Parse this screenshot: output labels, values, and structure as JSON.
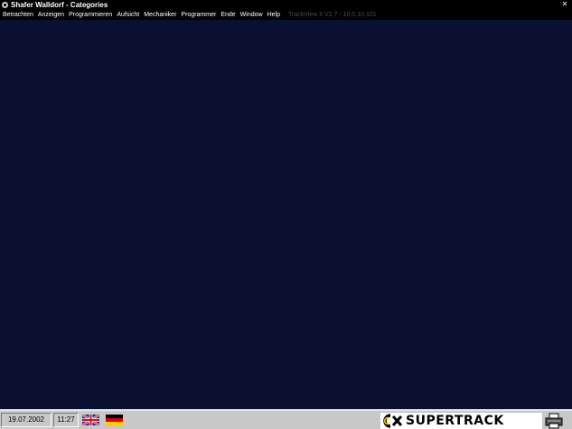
{
  "window": {
    "title": "Shafer Walldorf - Categories",
    "close_glyph": "✕"
  },
  "menu": {
    "items": [
      "Betrachten",
      "Anzeigen",
      "Programmieren",
      "Aufsicht",
      "Mechaniker",
      "Programmer",
      "Ende",
      "Window",
      "Help"
    ],
    "version": "TrackView II V2.7 - 10.0.10.101"
  },
  "status": {
    "date": "19.07.2002",
    "time": "11:27",
    "flags": [
      "uk-flag-icon",
      "germany-flag-icon"
    ]
  },
  "brand": {
    "name": "SUPERTRACK",
    "accent": "#f0d000"
  },
  "colors": {
    "canvas": "#0c1030",
    "bar": "#000000",
    "statusbar": "#c8c8c8"
  }
}
